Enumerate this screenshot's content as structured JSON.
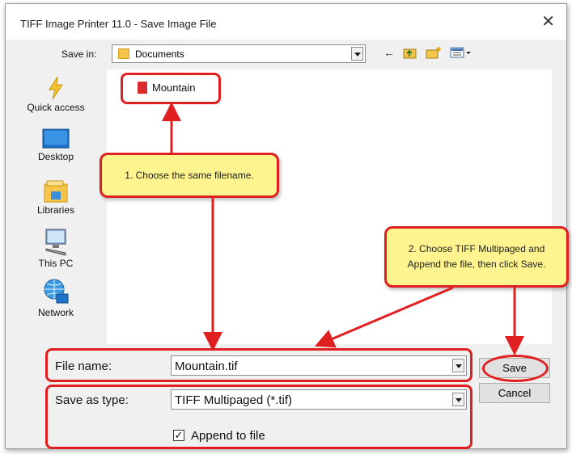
{
  "window": {
    "title": "TIFF Image Printer 11.0 - Save Image File"
  },
  "save_in": {
    "label": "Save in:",
    "value": "Documents"
  },
  "places": [
    {
      "id": "quick-access",
      "label": "Quick access"
    },
    {
      "id": "desktop",
      "label": "Desktop"
    },
    {
      "id": "libraries",
      "label": "Libraries"
    },
    {
      "id": "this-pc",
      "label": "This PC"
    },
    {
      "id": "network",
      "label": "Network"
    }
  ],
  "files": [
    {
      "name": "Mountain"
    }
  ],
  "form": {
    "filename_label": "File name:",
    "filename_value": "Mountain.tif",
    "type_label": "Save as type:",
    "type_value": "TIFF Multipaged (*.tif)",
    "append_label": "Append to file",
    "append_checked": true
  },
  "buttons": {
    "save": "Save",
    "cancel": "Cancel"
  },
  "callouts": {
    "one": "1. Choose the same filename.",
    "two_line1": "2. Choose TIFF Multipaged and",
    "two_line2": "Append the file, then click Save."
  },
  "colors": {
    "highlight": "#e02020",
    "callout_bg": "#fdf38f",
    "dialog_bg": "#f0f0f0"
  }
}
